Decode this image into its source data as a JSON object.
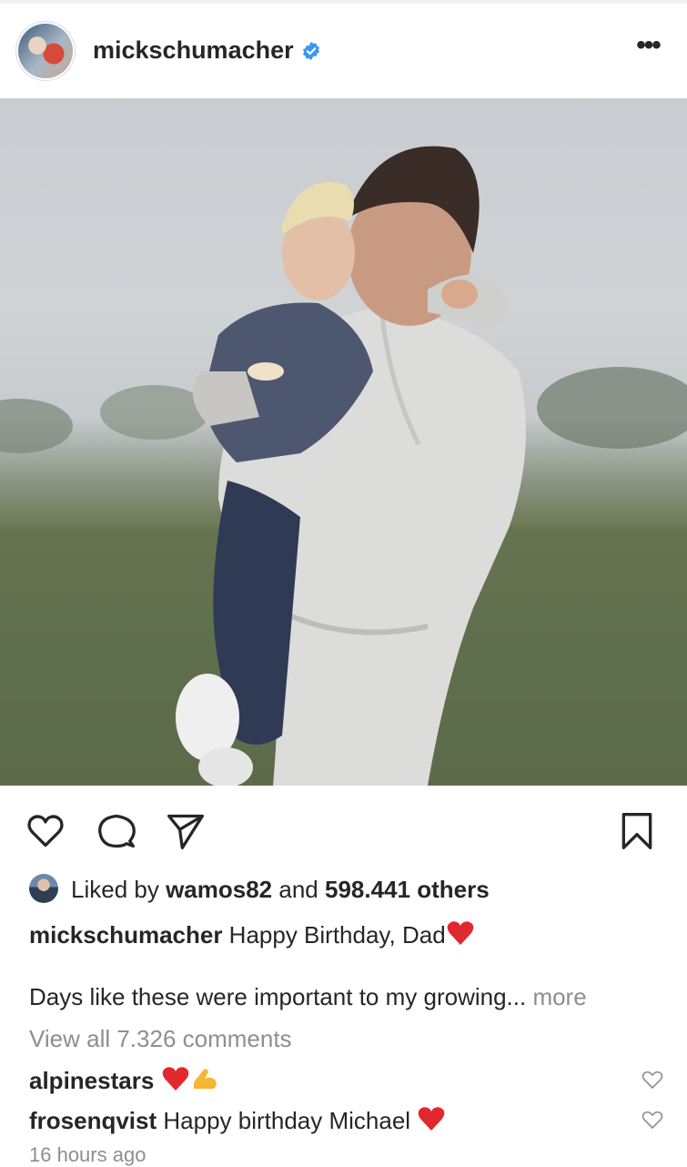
{
  "post": {
    "username": "mickschumacher",
    "verified": true,
    "more_label": "•••"
  },
  "image": {
    "description_icon": "photo"
  },
  "actions": {
    "like_icon": "heart-outline-icon",
    "comment_icon": "comment-bubble-icon",
    "share_icon": "paper-plane-icon",
    "save_icon": "bookmark-icon"
  },
  "likes": {
    "prefix": "Liked by ",
    "user": "wamos82",
    "middle": " and ",
    "count": "598.441 others"
  },
  "caption": {
    "username": "mickschumacher",
    "text": " Happy Birthday, Dad",
    "line2": "Days like these were important to my growing...",
    "more": " more"
  },
  "comments": {
    "view_all": "View all 7.326 comments",
    "items": [
      {
        "username": "alpinestars",
        "text": " "
      },
      {
        "username": "frosenqvist",
        "text": " Happy birthday Michael "
      }
    ]
  },
  "timestamp": "16 hours ago",
  "colors": {
    "text": "#262626",
    "secondary": "#8e8e8e",
    "verified": "#3897f0",
    "emoji_red": "#e0282e"
  }
}
